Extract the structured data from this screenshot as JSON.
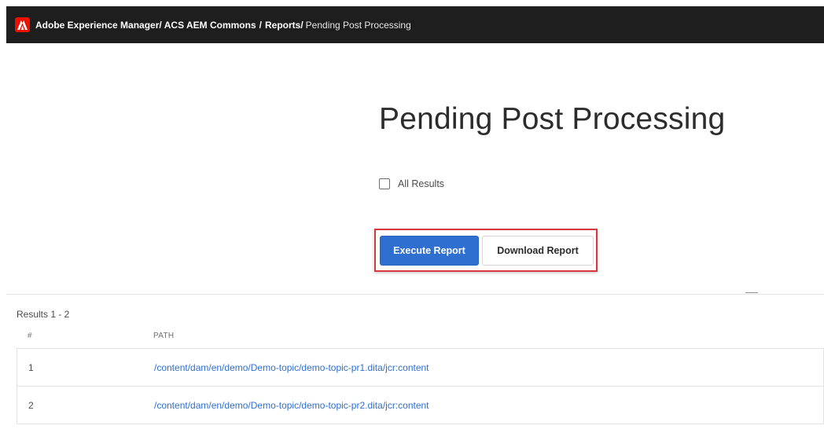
{
  "header": {
    "logo": "adobe-logo",
    "breadcrumbs": [
      {
        "label": "Adobe Experience Manager"
      },
      {
        "label": "ACS AEM Commons"
      },
      {
        "label": "Reports"
      },
      {
        "label": "Pending Post Processing"
      }
    ],
    "separator": "/"
  },
  "main": {
    "title": "Pending Post Processing",
    "all_results_label": "All Results",
    "execute_label": "Execute Report",
    "download_label": "Download Report"
  },
  "results": {
    "count_text": "Results 1 - 2",
    "columns": [
      "#",
      "PATH"
    ],
    "rows": [
      {
        "num": "1",
        "path": "/content/dam/en/demo/Demo-topic/demo-topic-pr1.dita/jcr:content"
      },
      {
        "num": "2",
        "path": "/content/dam/en/demo/Demo-topic/demo-topic-pr2.dita/jcr:content"
      }
    ]
  },
  "colors": {
    "header_bg": "#1e1e1e",
    "adobe_red": "#eb1000",
    "primary_button": "#2f6fd0",
    "highlight_border": "#d7373f",
    "link": "#2f6fd0"
  }
}
